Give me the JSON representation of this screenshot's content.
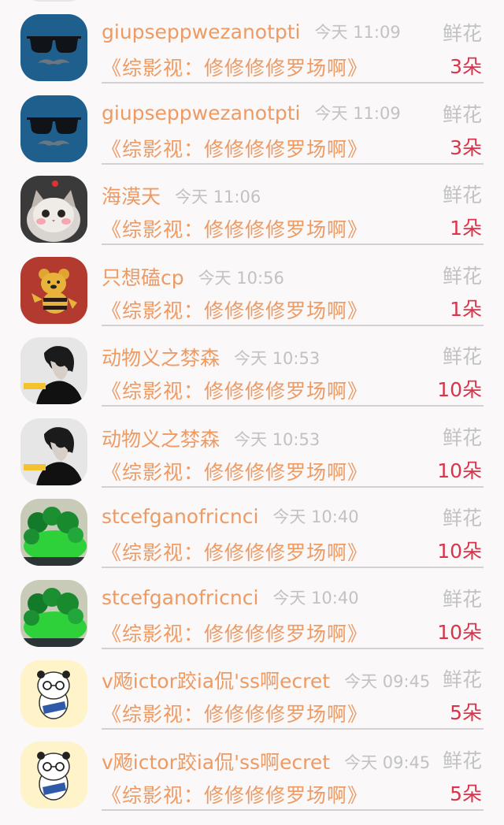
{
  "entries": [
    {
      "name": "giupseppwezanotpti",
      "time": "今天 11:09",
      "gift": "鲜花",
      "message": "《综影视：修修修修罗场啊》",
      "count": "3朵",
      "avatar": "sunglasses-mustache-avatar"
    },
    {
      "name": "giupseppwezanotpti",
      "time": "今天 11:09",
      "gift": "鲜花",
      "message": "《综影视：修修修修罗场啊》",
      "count": "3朵",
      "avatar": "sunglasses-mustache-avatar"
    },
    {
      "name": "海漠天",
      "time": "今天 11:06",
      "gift": "鲜花",
      "message": "《综影视：修修修修罗场啊》",
      "count": "1朵",
      "avatar": "cat-avatar"
    },
    {
      "name": "只想磕cp",
      "time": "今天 10:56",
      "gift": "鲜花",
      "message": "《综影视：修修修修罗场啊》",
      "count": "1朵",
      "avatar": "bear-bee-avatar"
    },
    {
      "name": "动物义之棼森",
      "time": "今天 10:53",
      "gift": "鲜花",
      "message": "《综影视：修修修修罗场啊》",
      "count": "10朵",
      "avatar": "portrait-avatar"
    },
    {
      "name": "动物义之棼森",
      "time": "今天 10:53",
      "gift": "鲜花",
      "message": "《综影视：修修修修罗场啊》",
      "count": "10朵",
      "avatar": "portrait-avatar"
    },
    {
      "name": "stcefganofricnci",
      "time": "今天 10:40",
      "gift": "鲜花",
      "message": "《综影视：修修修修罗场啊》",
      "count": "10朵",
      "avatar": "jade-carving-avatar"
    },
    {
      "name": "stcefganofricnci",
      "time": "今天 10:40",
      "gift": "鲜花",
      "message": "《综影视：修修修修罗场啊》",
      "count": "10朵",
      "avatar": "jade-carving-avatar"
    },
    {
      "name": "v飏ictor跤ia侃'ss啊ecret",
      "time": "今天 09:45",
      "gift": "鲜花",
      "message": "《综影视：修修修修罗场啊》",
      "count": "5朵",
      "avatar": "panda-cartoon-avatar"
    },
    {
      "name": "v飏ictor跤ia侃'ss啊ecret",
      "time": "今天 09:45",
      "gift": "鲜花",
      "message": "《综影视：修修修修罗场啊》",
      "count": "5朵",
      "avatar": "panda-cartoon-avatar"
    }
  ],
  "colors": {
    "name": "#ee9a63",
    "time": "#c2c2c2",
    "count": "#d9344a",
    "divider": "#d4d1d3",
    "background": "#faf8f9"
  }
}
